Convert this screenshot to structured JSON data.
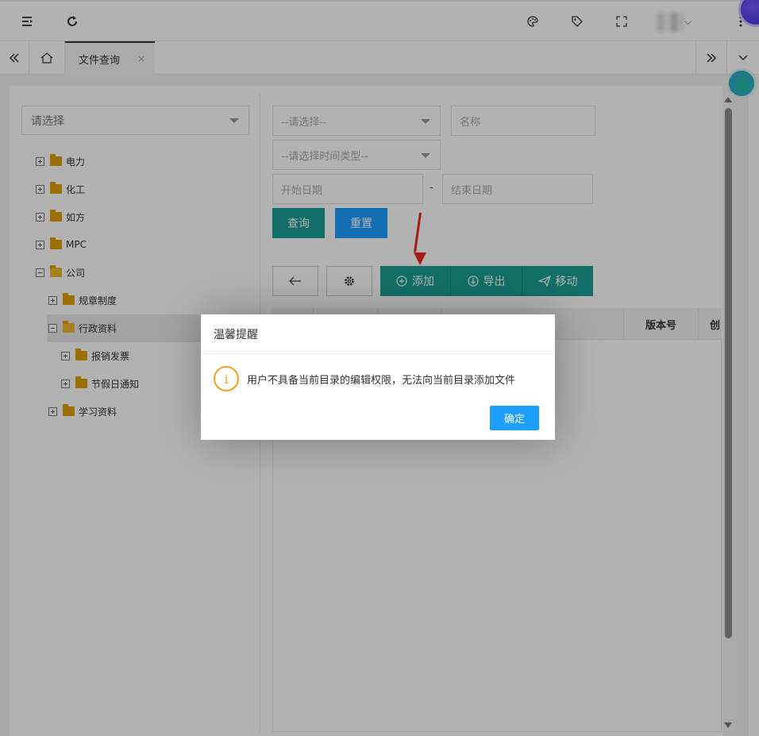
{
  "tabs": {
    "active_label": "文件查询",
    "close_glyph": "×"
  },
  "tree": {
    "select_placeholder": "请选择",
    "nodes": [
      {
        "label": "电力"
      },
      {
        "label": "化工"
      },
      {
        "label": "如方"
      },
      {
        "label": "MPC"
      },
      {
        "label": "公司"
      },
      {
        "label": "规章制度"
      },
      {
        "label": "行政资料"
      },
      {
        "label": "报销发票"
      },
      {
        "label": "节假日通知"
      },
      {
        "label": "学习资料"
      }
    ]
  },
  "filters": {
    "select1_placeholder": "--请选择--",
    "name_placeholder": "名称",
    "time_type_placeholder": "--请选择时间类型--",
    "start_date_placeholder": "开始日期",
    "date_separator": "-",
    "end_date_placeholder": "结束日期",
    "query_label": "查询",
    "reset_label": "重置"
  },
  "toolbar": {
    "add_label": "添加",
    "export_label": "导出",
    "move_label": "移动"
  },
  "table": {
    "headers": [
      "版本号",
      "创"
    ]
  },
  "dialog": {
    "title": "温馨提醒",
    "message": "用户不具备当前目录的编辑权限，无法向当前目录添加文件",
    "info_glyph": "i",
    "confirm_label": "确定"
  },
  "colors": {
    "teal": "#1aa094",
    "blue": "#1e9fff",
    "warning": "#f0a020",
    "arrow": "#e82a1c"
  }
}
